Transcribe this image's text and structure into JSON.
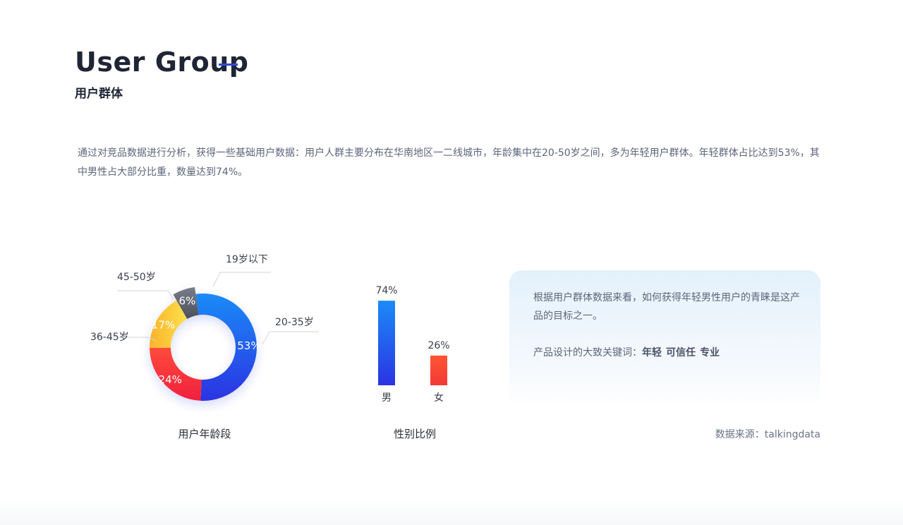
{
  "header": {
    "title": "User Group",
    "subtitle": "用户群体"
  },
  "intro": "通过对竞品数据进行分析，获得一些基础用户数据：用户人群主要分布在华南地区一二线城市，年龄集中在20-50岁之间，多为年轻用户群体。年轻群体占比达到53%，其中男性占大部分比重，数量达到74%。",
  "chart_data": [
    {
      "type": "pie",
      "variant": "donut",
      "caption": "用户年龄段",
      "slices": [
        {
          "label": "20-35岁",
          "value": 53,
          "display": "53%",
          "color": "#2a3fe0"
        },
        {
          "label": "36-45岁",
          "value": 24,
          "display": "24%",
          "color": "#f0303c"
        },
        {
          "label": "45-50岁",
          "value": 17,
          "display": "17%",
          "color": "#fcc12d"
        },
        {
          "label": "19岁以下",
          "value": 6,
          "display": "6%",
          "color": "#5b5f6c"
        }
      ]
    },
    {
      "type": "bar",
      "caption": "性别比例",
      "categories": [
        "男",
        "女"
      ],
      "values": [
        74,
        26
      ],
      "display": [
        "74%",
        "26%"
      ],
      "colors": [
        "#2a3fe0",
        "#ff5533"
      ],
      "ylim": [
        0,
        100
      ]
    }
  ],
  "card": {
    "text": "根据用户群体数据来看，如何获得年轻男性用户的青睐是这产品的目标之一。",
    "keywords_label": "产品设计的大致关键词：",
    "keywords": [
      "年轻",
      "可信任",
      "专业"
    ]
  },
  "source": "数据来源：talkingdata"
}
